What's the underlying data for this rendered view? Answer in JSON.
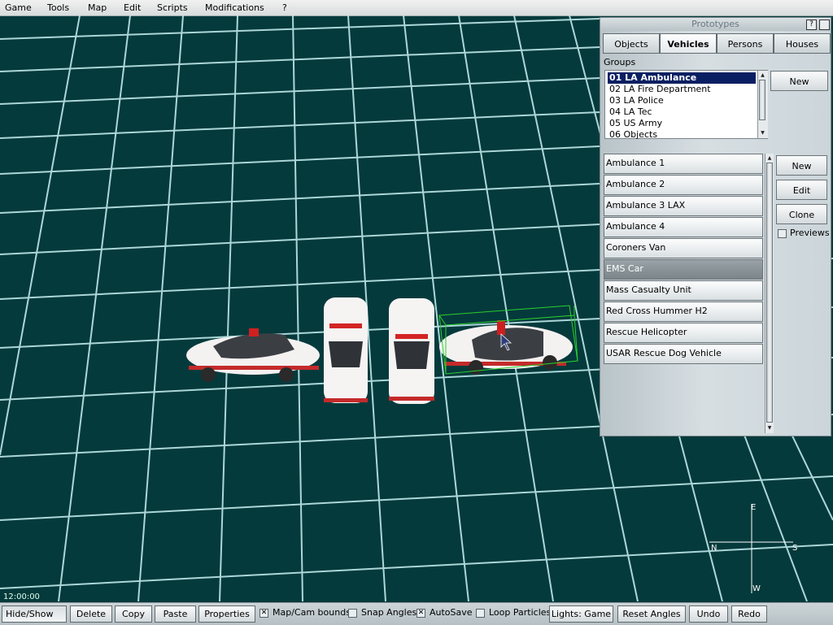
{
  "menu": [
    "Game",
    "Tools",
    "Map",
    "Edit",
    "Scripts",
    "Modifications",
    "?"
  ],
  "clock": "12:00:00",
  "compass": {
    "north": "N",
    "south": "S",
    "east": "E",
    "west": "W"
  },
  "panel": {
    "title": "Prototypes",
    "help_icon_label": "?",
    "tabs": [
      "Objects",
      "Vehicles",
      "Persons",
      "Houses"
    ],
    "active_tab": "Vehicles",
    "groups_label": "Groups",
    "groups": [
      "01 LA Ambulance",
      "02 LA Fire Department",
      "03 LA Police",
      "04 LA Tec",
      "05 US Army",
      "06 Objects"
    ],
    "selected_group": "01 LA Ambulance",
    "groups_new_label": "New",
    "prototypes": [
      "Ambulance 1",
      "Ambulance 2",
      "Ambulance 3 LAX",
      "Ambulance 4",
      "Coroners Van",
      "EMS Car",
      "Mass Casualty Unit",
      "Red Cross Hummer H2",
      "Rescue Helicopter",
      "USAR Rescue Dog Vehicle"
    ],
    "selected_prototype": "EMS Car",
    "buttons": {
      "new": "New",
      "edit": "Edit",
      "clone": "Clone"
    },
    "previews_label": "Previews",
    "previews_checked": false
  },
  "toolbar": {
    "hide_show": "Hide/Show",
    "delete": "Delete",
    "copy": "Copy",
    "paste": "Paste",
    "properties": "Properties",
    "map_cam_bounds": "Map/Cam bounds",
    "map_cam_bounds_checked": true,
    "snap_angles": "Snap Angles",
    "snap_angles_checked": false,
    "autosave": "AutoSave",
    "autosave_checked": true,
    "loop_particles": "Loop Particles",
    "loop_particles_checked": false,
    "lights": "Lights: Game",
    "reset_angles": "Reset Angles",
    "undo": "Undo",
    "redo": "Redo"
  },
  "colors": {
    "viewport_bg": "#053a3c",
    "grid": "#bfe9ea",
    "selection_box": "#2bd12b",
    "selected_group": "#0a1f62"
  }
}
